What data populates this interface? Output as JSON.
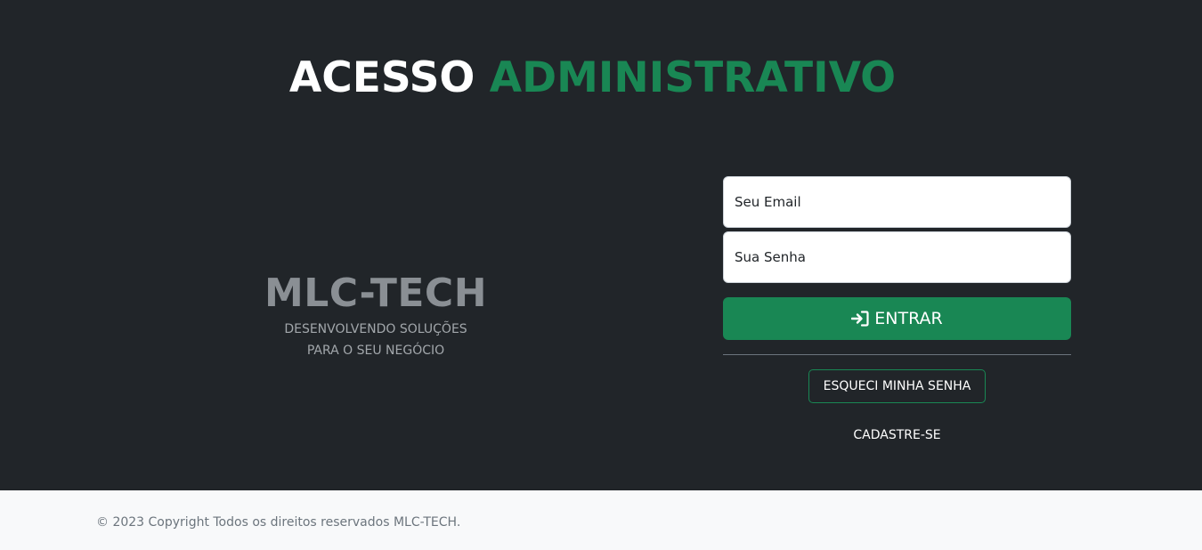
{
  "header": {
    "title_part1": "ACESSO",
    "title_part2": "ADMINISTRATIVO"
  },
  "brand": {
    "name": "MLC-TECH",
    "tagline_line1": "DESENVOLVENDO SOLUÇÕES",
    "tagline_line2": "PARA O SEU NEGÓCIO"
  },
  "login_form": {
    "email_placeholder": "Seu Email",
    "password_placeholder": "Sua Senha",
    "submit_label": "ENTRAR",
    "submit_icon": "sign-in-icon",
    "forgot_label": "ESQUECI MINHA SENHA",
    "signup_label": "CADASTRE-SE"
  },
  "footer": {
    "copyright": "© 2023 Copyright Todos os direitos reservados MLC-TECH."
  },
  "colors": {
    "background": "#212529",
    "accent": "#198754",
    "footer_bg": "#f8f9fa",
    "brand_text": "#8a8f94"
  }
}
